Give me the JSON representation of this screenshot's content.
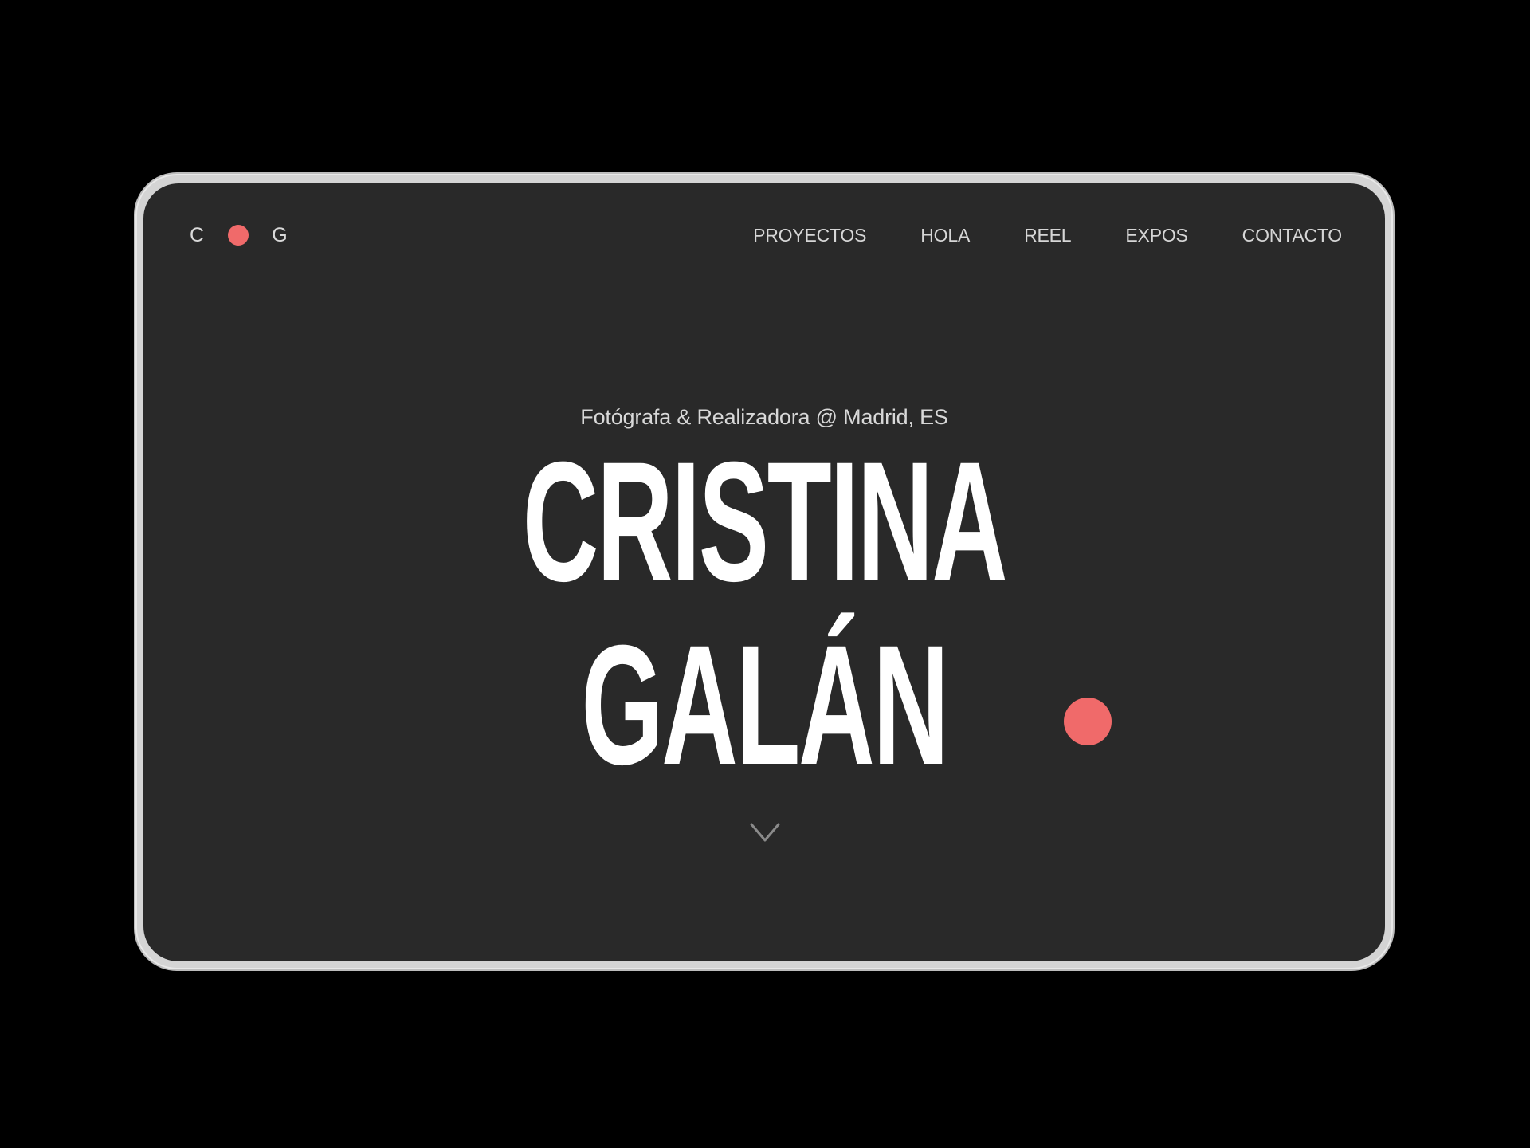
{
  "colors": {
    "accent": "#f06a6a",
    "screen_background": "#292929",
    "page_background": "#000000",
    "text": "#ffffff",
    "nav_text": "#d6d6d6"
  },
  "logo": {
    "first_letter": "C",
    "second_letter": "G"
  },
  "nav": {
    "items": [
      {
        "label": "PROYECTOS"
      },
      {
        "label": "HOLA"
      },
      {
        "label": "REEL"
      },
      {
        "label": "EXPOS"
      },
      {
        "label": "CONTACTO"
      }
    ]
  },
  "hero": {
    "subtitle": "Fotógrafa & Realizadora @ Madrid, ES",
    "name_line_1": "CRISTINA",
    "name_line_2": "GALÁN",
    "scroll_icon": "chevron-down-icon"
  }
}
